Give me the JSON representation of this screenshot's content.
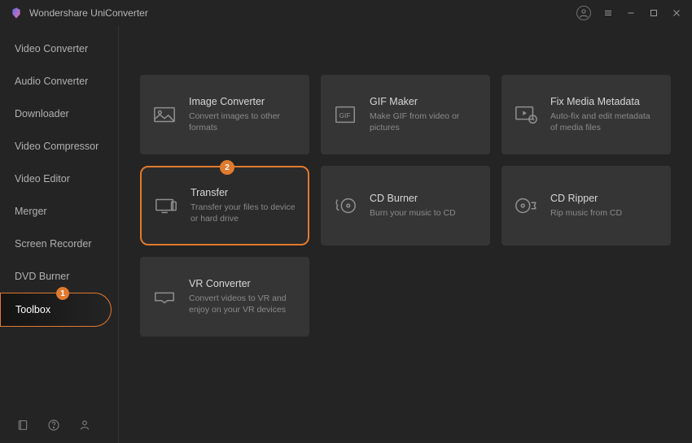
{
  "app": {
    "title": "Wondershare UniConverter"
  },
  "accent": "#e07a2e",
  "sidebar": {
    "items": [
      {
        "label": "Video Converter"
      },
      {
        "label": "Audio Converter"
      },
      {
        "label": "Downloader"
      },
      {
        "label": "Video Compressor"
      },
      {
        "label": "Video Editor"
      },
      {
        "label": "Merger"
      },
      {
        "label": "Screen Recorder"
      },
      {
        "label": "DVD Burner"
      },
      {
        "label": "Toolbox",
        "active": true,
        "badge": "1"
      }
    ]
  },
  "cards": [
    {
      "title": "Image Converter",
      "desc": "Convert images to other formats"
    },
    {
      "title": "GIF Maker",
      "desc": "Make GIF from video or pictures"
    },
    {
      "title": "Fix Media Metadata",
      "desc": "Auto-fix and edit metadata of media files"
    },
    {
      "title": "Transfer",
      "desc": "Transfer your files to device or hard drive",
      "highlight": true,
      "badge": "2"
    },
    {
      "title": "CD Burner",
      "desc": "Burn your music to CD"
    },
    {
      "title": "CD Ripper",
      "desc": "Rip music from CD"
    },
    {
      "title": "VR Converter",
      "desc": "Convert videos to VR and enjoy on your VR devices"
    }
  ]
}
